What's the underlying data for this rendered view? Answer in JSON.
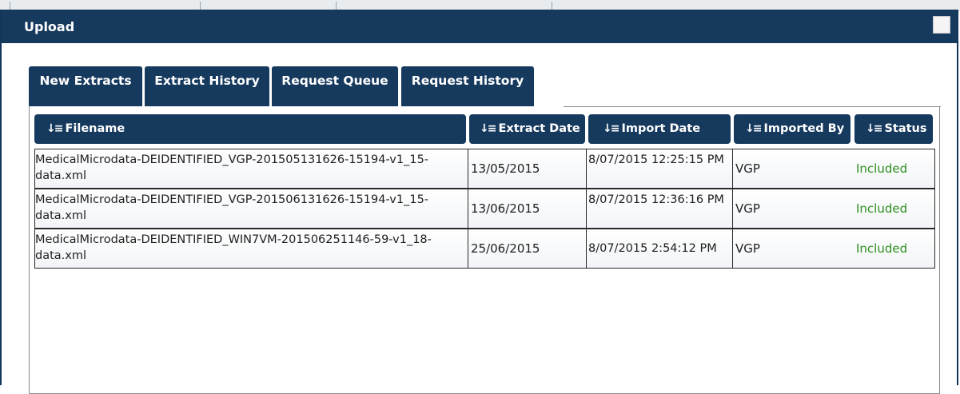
{
  "window": {
    "title": "Upload"
  },
  "tabs": [
    {
      "label": "New Extracts"
    },
    {
      "label": "Extract History"
    },
    {
      "label": "Request Queue"
    },
    {
      "label": "Request History"
    }
  ],
  "table": {
    "columns": [
      {
        "label": "Filename"
      },
      {
        "label": "Extract Date"
      },
      {
        "label": "Import Date"
      },
      {
        "label": "Imported By"
      },
      {
        "label": "Status"
      }
    ],
    "rows": [
      {
        "filename": "MedicalMicrodata-DEIDENTIFIED_VGP-201505131626-15194-v1_15-data.xml",
        "extract_date": "13/05/2015",
        "import_date": "8/07/2015 12:25:15 PM",
        "imported_by": "VGP",
        "status": "Included"
      },
      {
        "filename": "MedicalMicrodata-DEIDENTIFIED_VGP-201506131626-15194-v1_15-data.xml",
        "extract_date": "13/06/2015",
        "import_date": "8/07/2015 12:36:16 PM",
        "imported_by": "VGP",
        "status": "Included"
      },
      {
        "filename": "MedicalMicrodata-DEIDENTIFIED_WIN7VM-201506251146-59-v1_18-data.xml",
        "extract_date": "25/06/2015",
        "import_date": "8/07/2015 2:54:12 PM",
        "imported_by": "VGP",
        "status": "Included"
      }
    ]
  },
  "icons": {
    "sort": "sort-icon",
    "window_button": "maximize-icon"
  },
  "colors": {
    "header_navy": "#16395e",
    "status_green": "#2c8f1d"
  }
}
